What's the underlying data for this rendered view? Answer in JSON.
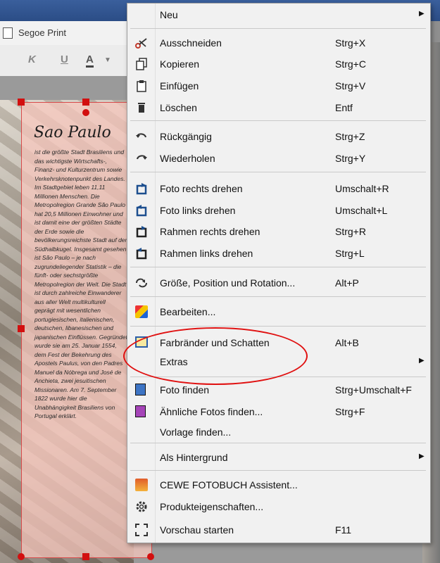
{
  "toolbar": {
    "font_name": "Segoe Print",
    "italic_label": "K",
    "underline_label": "U",
    "color_label": "A"
  },
  "page": {
    "headline": "Sao Paulo",
    "body": "ist die größte Stadt Brasiliens und das wichtigste Wirtschafts-, Finanz- und Kulturzentrum sowie Verkehrsknotenpunkt des Landes. Im Stadtgebiet leben 11,11 Millionen Menschen. Die Metropolregion Grande São Paulo hat 20,5 Millionen Einwohner und ist damit eine der größten Städte der Erde sowie die bevölkerungsreichste Stadt auf der Südhalbkugel. Insgesamt gesehen ist São Paulo – je nach zugrundeliegender Statistik – die fünft- oder sechstgrößte Metropolregion der Welt. Die Stadt ist durch zahlreiche Einwanderer aus aller Welt multikulturell geprägt mit wesentlichen portugiesischen, italienischen, deutschen, libanesischen und japanischen Einflüssen. Gegründet wurde sie am 25. Januar 1554, dem Fest der Bekehrung des Apostels Paulus, von den Padres Manuel da Nóbrega und José de Anchieta, zwei jesuitischen Missionaren. Am 7. September 1822 wurde hier die Unabhängigkeit Brasiliens von Portugal erklärt."
  },
  "menu": {
    "items": [
      {
        "label": "Neu",
        "shortcut": "",
        "icon": "none",
        "submenu": true
      },
      {
        "label": "Ausschneiden",
        "shortcut": "Strg+X",
        "icon": "scissors-icon"
      },
      {
        "label": "Kopieren",
        "shortcut": "Strg+C",
        "icon": "copy-icon"
      },
      {
        "label": "Einfügen",
        "shortcut": "Strg+V",
        "icon": "paste-icon"
      },
      {
        "label": "Löschen",
        "shortcut": "Entf",
        "icon": "trash-icon"
      },
      {
        "label": "Rückgängig",
        "shortcut": "Strg+Z",
        "icon": "undo-icon"
      },
      {
        "label": "Wiederholen",
        "shortcut": "Strg+Y",
        "icon": "redo-icon"
      },
      {
        "label": "Foto rechts drehen",
        "shortcut": "Umschalt+R",
        "icon": "rotate-right-icon"
      },
      {
        "label": "Foto links drehen",
        "shortcut": "Umschalt+L",
        "icon": "rotate-left-icon"
      },
      {
        "label": "Rahmen rechts drehen",
        "shortcut": "Strg+R",
        "icon": "frame-rotate-right-icon"
      },
      {
        "label": "Rahmen links drehen",
        "shortcut": "Strg+L",
        "icon": "frame-rotate-left-icon"
      },
      {
        "label": "Größe, Position und Rotation...",
        "shortcut": "Alt+P",
        "icon": "transform-icon"
      },
      {
        "label": "Bearbeiten...",
        "shortcut": "",
        "icon": "edit-color-icon"
      },
      {
        "label": "Farbränder und Schatten",
        "shortcut": "Alt+B",
        "icon": "border-shadow-icon"
      },
      {
        "label": "Extras",
        "shortcut": "",
        "icon": "none",
        "submenu": true
      },
      {
        "label": "Foto finden",
        "shortcut": "Strg+Umschalt+F",
        "icon": "find-photo-icon"
      },
      {
        "label": "Ähnliche Fotos finden...",
        "shortcut": "Strg+F",
        "icon": "similar-photos-icon"
      },
      {
        "label": "Vorlage finden...",
        "shortcut": "",
        "icon": "none"
      },
      {
        "label": "Als Hintergrund",
        "shortcut": "",
        "icon": "none",
        "submenu": true
      },
      {
        "label": "CEWE FOTOBUCH Assistent...",
        "shortcut": "",
        "icon": "assistant-icon"
      },
      {
        "label": "Produkteigenschaften...",
        "shortcut": "",
        "icon": "gear-icon"
      },
      {
        "label": "Vorschau starten",
        "shortcut": "F11",
        "icon": "fullscreen-icon"
      }
    ],
    "submenu_arrow": "▶"
  },
  "colors": {
    "annotation": "#e01010",
    "handle": "#d20f0f",
    "menu_bg": "#f1f1f1"
  }
}
